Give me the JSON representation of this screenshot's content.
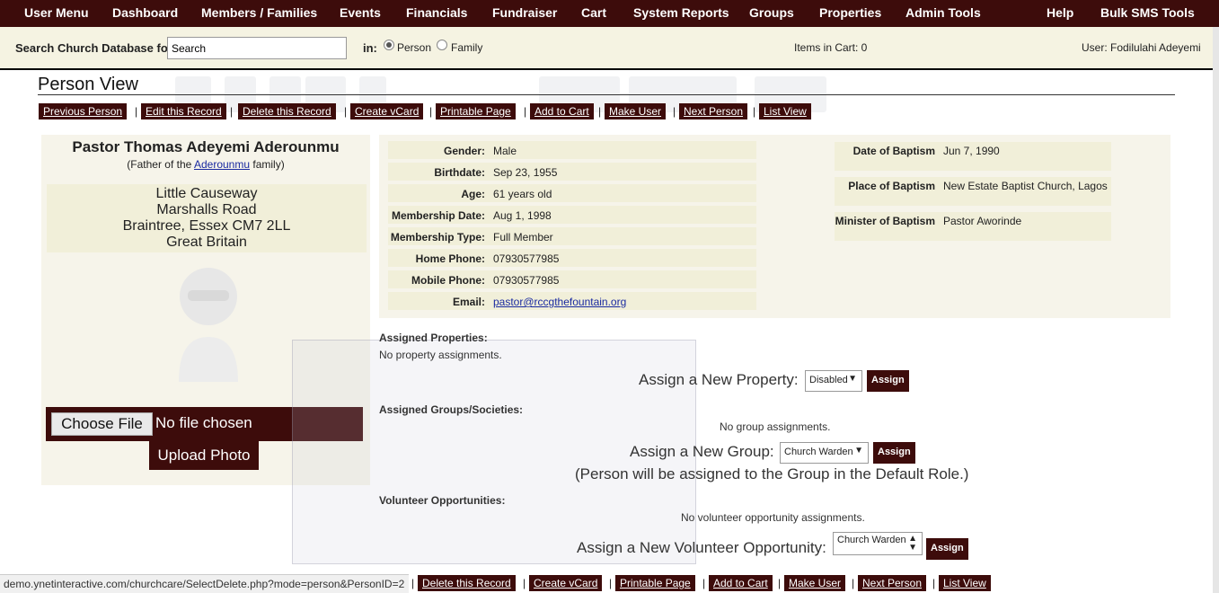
{
  "topnav": [
    "User Menu",
    "Dashboard",
    "Members / Families",
    "Events",
    "Financials",
    "Fundraiser",
    "Cart",
    "System Reports",
    "Groups",
    "Properties",
    "Admin Tools",
    "Help",
    "Bulk SMS Tools"
  ],
  "search": {
    "label": "Search Church Database for:",
    "value": "Search",
    "in_label": "in:",
    "opt_person": "Person",
    "opt_family": "Family"
  },
  "cart": "Items in Cart: 0",
  "user": "User: Fodilulahi Adeyemi",
  "page_title": "Person View",
  "actions_top": [
    "Previous Person",
    "Edit this Record",
    "Delete this Record",
    "Create vCard",
    "Printable Page",
    "Add to Cart",
    "Make User",
    "Next Person",
    "List View"
  ],
  "separator": "|",
  "person": {
    "name": "Pastor Thomas Adeyemi Aderounmu",
    "family_prefix": "(Father of the",
    "family_link": "Aderounmu",
    "family_suffix": "family)",
    "address": [
      "Little Causeway",
      "Marshalls Road",
      "Braintree, Essex CM7 2LL",
      "Great Britain"
    ]
  },
  "upload": {
    "choose": "Choose File",
    "nofile": "No file chosen",
    "upload": "Upload Photo"
  },
  "details": [
    {
      "label": "Gender:",
      "value": "Male"
    },
    {
      "label": "Birthdate:",
      "value": "Sep 23, 1955"
    },
    {
      "label": "Age:",
      "value": "61 years old"
    },
    {
      "label": "Membership Date:",
      "value": "Aug 1, 1998"
    },
    {
      "label": "Membership Type:",
      "value": "Full Member"
    },
    {
      "label": "Home Phone:",
      "value": "07930577985"
    },
    {
      "label": "Mobile Phone:",
      "value": "07930577985"
    },
    {
      "label": "Email:",
      "value": "pastor@rccgthefountain.org"
    }
  ],
  "baptism": [
    {
      "label": "Date of Baptism",
      "value": "Jun 7, 1990"
    },
    {
      "label": "Place of Baptism",
      "value": "New Estate Baptist Church, Lagos"
    },
    {
      "label": "Minister of Baptism",
      "value": "Pastor Aworinde"
    }
  ],
  "properties": {
    "title": "Assigned Properties:",
    "empty": "No property assignments.",
    "assign_label": "Assign a New Property:",
    "select": "Disabled",
    "button": "Assign"
  },
  "groups": {
    "title": "Assigned Groups/Societies:",
    "empty": "No group assignments.",
    "assign_label": "Assign a New Group:",
    "select": "Church Warden",
    "button": "Assign",
    "note": "(Person will be assigned to the Group in the Default Role.)"
  },
  "volunteer": {
    "title": "Volunteer Opportunities:",
    "empty": "No volunteer opportunity assignments.",
    "assign_label": "Assign a New Volunteer Opportunity:",
    "select": "Church Warden",
    "button": "Assign"
  },
  "status_url": "demo.ynetinteractive.com/churchcare/SelectDelete.php?mode=person&PersonID=2",
  "actions_bottom": [
    "Delete this Record",
    "Create vCard",
    "Printable Page",
    "Add to Cart",
    "Make User",
    "Next Person",
    "List View"
  ]
}
